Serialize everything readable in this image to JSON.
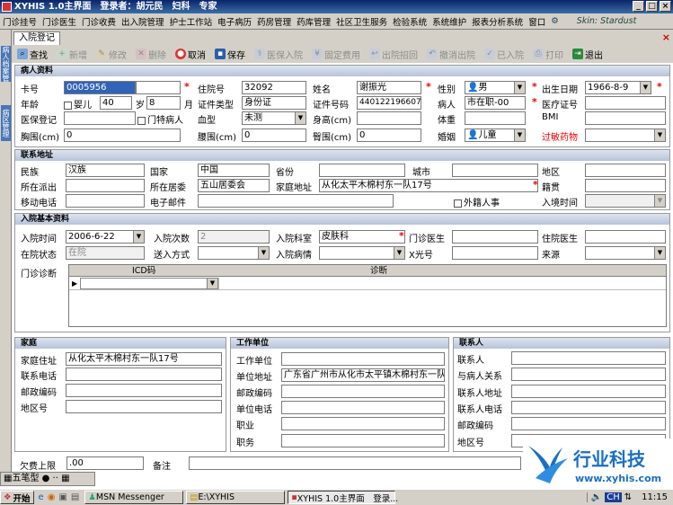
{
  "window": {
    "title": "XYHIS 1.0主界面　登录者：胡元民　妇科　专家"
  },
  "menu": [
    "门诊挂号",
    "门诊医生",
    "门诊收费",
    "出入院管理",
    "护士工作站",
    "电子病历",
    "药房管理",
    "药库管理",
    "社区卫生服务",
    "检验系统",
    "系统维护",
    "报表分析系统",
    "窗口"
  ],
  "skin_label": "Skin: Stardust",
  "side_tabs": [
    "病人档案管理",
    "病区管理"
  ],
  "tab": {
    "label": "入院登记"
  },
  "toolbar": [
    {
      "label": "查找",
      "icon": "search-icon",
      "enabled": true
    },
    {
      "label": "新增",
      "icon": "add-icon",
      "enabled": false
    },
    {
      "label": "修改",
      "icon": "edit-icon",
      "enabled": false
    },
    {
      "label": "删除",
      "icon": "delete-icon",
      "enabled": false
    },
    {
      "label": "取消",
      "icon": "cancel-icon",
      "enabled": true
    },
    {
      "label": "保存",
      "icon": "save-icon",
      "enabled": true
    },
    {
      "label": "医保入院",
      "icon": "insurance-icon",
      "enabled": false
    },
    {
      "label": "固定费用",
      "icon": "fee-icon",
      "enabled": false
    },
    {
      "label": "出院招回",
      "icon": "recall-icon",
      "enabled": false
    },
    {
      "label": "撤消出院",
      "icon": "undo-icon",
      "enabled": false
    },
    {
      "label": "已入院",
      "icon": "admitted-icon",
      "enabled": false
    },
    {
      "label": "打印",
      "icon": "print-icon",
      "enabled": false
    },
    {
      "label": "退出",
      "icon": "exit-icon",
      "enabled": true
    }
  ],
  "patient": {
    "header": "病人资料",
    "card_no_label": "卡号",
    "card_no": "0005956",
    "inpatient_no_label": "住院号",
    "inpatient_no": "32092",
    "name_label": "姓名",
    "name": "谢振光",
    "gender_label": "性别",
    "gender": "男",
    "birth_label": "出生日期",
    "birth": "1966-8-9",
    "age_label": "年龄",
    "infant_label": "婴儿",
    "age": "40",
    "year_unit": "岁",
    "age_month": "8",
    "month_unit": "月",
    "id_type_label": "证件类型",
    "id_type": "身份证",
    "id_no_label": "证件号码",
    "id_no": "4401221966072",
    "patient_type_label": "病人",
    "patient_type": "市在职-00",
    "med_card_label": "医疗证号",
    "med_card": "",
    "insurance_label": "医保登记",
    "special_label": "门特病人",
    "blood_label": "血型",
    "blood": "未测",
    "height_label": "身高(cm)",
    "height": "",
    "weight_label": "体重",
    "weight": "",
    "bmi_label": "BMI",
    "bmi": "",
    "chest_label": "胸围(cm)",
    "chest": "0",
    "waist_label": "腰围(cm)",
    "waist": "0",
    "hip_label": "臀围(cm)",
    "hip": "0",
    "marriage_label": "婚姻",
    "marriage": "儿童",
    "allergy_label": "过敏药物",
    "allergy": ""
  },
  "contact": {
    "header": "联系地址",
    "ethnic_label": "民族",
    "ethnic": "汉族",
    "country_label": "国家",
    "country": "中国",
    "province_label": "省份",
    "province": "",
    "city_label": "城市",
    "city": "",
    "district_label": "地区",
    "district": "",
    "police_label": "所在派出",
    "police": "",
    "committee_label": "所在居委",
    "committee": "五山居委会",
    "home_address_label": "家庭地址",
    "home_address": "从化太平木棉村东一队17号",
    "native_label": "籍贯",
    "native": "",
    "mobile_label": "移动电话",
    "mobile": "",
    "email_label": "电子邮件",
    "email": "",
    "foreign_label": "外籍人事",
    "entry_time_label": "入境时间",
    "entry_time": ""
  },
  "admission": {
    "header": "入院基本资料",
    "time_label": "入院时间",
    "time": "2006-6-22",
    "count_label": "入院次数",
    "count": "2",
    "dept_label": "入院科室",
    "dept": "皮肤科",
    "clinic_doctor_label": "门诊医生",
    "clinic_doctor": "",
    "ward_doctor_label": "住院医生",
    "ward_doctor": "",
    "status_label": "在院状态",
    "status": "在院",
    "method_label": "送入方式",
    "method": "",
    "condition_label": "入院病情",
    "condition": "",
    "xray_label": "X光号",
    "xray": "",
    "source_label": "来源",
    "source": "",
    "diagnosis_label": "门诊诊断",
    "grid_headers": [
      "ICD码",
      "诊断"
    ]
  },
  "family": {
    "header": "家庭",
    "address_label": "家庭住址",
    "address": "从化太平木棉村东一队17号",
    "phone_label": "联系电话",
    "phone": "",
    "postcode_label": "邮政编码",
    "postcode": "",
    "area_label": "地区号",
    "area": ""
  },
  "work": {
    "header": "工作单位",
    "unit_label": "工作单位",
    "unit": "",
    "address_label": "单位地址",
    "address": "广东省广州市从化市太平镇木棉村东一队",
    "postcode_label": "邮政编码",
    "postcode": "",
    "phone_label": "单位电话",
    "phone": "",
    "job_label": "职业",
    "job": "",
    "duty_label": "职务",
    "duty": ""
  },
  "relation": {
    "header": "联系人",
    "person_label": "联系人",
    "person": "",
    "relation_label": "与病人关系",
    "relation": "",
    "address_label": "联系人地址",
    "address": "",
    "phone_label": "联系人电话",
    "phone": "",
    "postcode_label": "邮政编码",
    "postcode": "",
    "area_label": "地区号",
    "area": ""
  },
  "footer": {
    "arrears_label": "欠费上限",
    "arrears": ".00",
    "remark_label": "备注",
    "remark": ""
  },
  "ime": {
    "label": "五笔型"
  },
  "taskbar": {
    "start": "开始",
    "items": [
      "MSN Messenger",
      "E:\\XYHIS",
      "XYHIS 1.0主界面　登录..."
    ],
    "tray_lang": "CH",
    "clock": "11:15"
  },
  "logo": {
    "name": "行业科技",
    "url": "www.xyhis.com",
    "colors": [
      "#1a6fc4",
      "#2e8de0"
    ]
  }
}
